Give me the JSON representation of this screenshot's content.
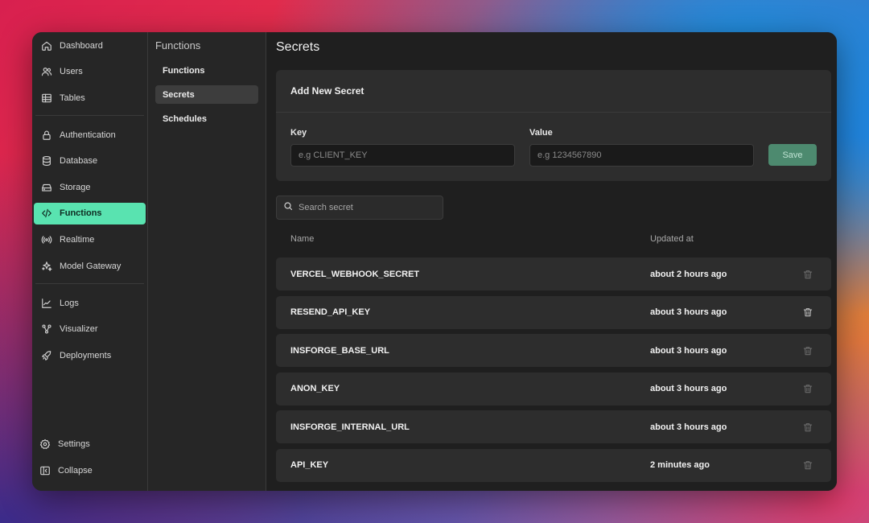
{
  "sidebar": {
    "groups": [
      [
        {
          "label": "Dashboard",
          "icon": "home-icon"
        },
        {
          "label": "Users",
          "icon": "users-icon"
        },
        {
          "label": "Tables",
          "icon": "table-icon"
        }
      ],
      [
        {
          "label": "Authentication",
          "icon": "lock-icon"
        },
        {
          "label": "Database",
          "icon": "database-icon"
        },
        {
          "label": "Storage",
          "icon": "storage-icon"
        },
        {
          "label": "Functions",
          "icon": "code-icon",
          "active": true
        },
        {
          "label": "Realtime",
          "icon": "broadcast-icon"
        },
        {
          "label": "Model Gateway",
          "icon": "sparkles-icon"
        }
      ],
      [
        {
          "label": "Logs",
          "icon": "chart-line-icon"
        },
        {
          "label": "Visualizer",
          "icon": "graph-icon"
        },
        {
          "label": "Deployments",
          "icon": "rocket-icon"
        }
      ]
    ],
    "bottom": [
      {
        "label": "Settings",
        "icon": "gear-icon"
      },
      {
        "label": "Collapse",
        "icon": "collapse-icon"
      }
    ],
    "accent_color": "#59e3b0"
  },
  "subnav": {
    "title": "Functions",
    "items": [
      {
        "label": "Functions"
      },
      {
        "label": "Secrets",
        "active": true
      },
      {
        "label": "Schedules"
      }
    ]
  },
  "main": {
    "title": "Secrets",
    "add_card": {
      "title": "Add New Secret",
      "key_label": "Key",
      "key_placeholder": "e.g CLIENT_KEY",
      "key_value": "",
      "value_label": "Value",
      "value_placeholder": "e.g 1234567890",
      "value_value": "",
      "save_label": "Save"
    },
    "search": {
      "placeholder": "Search secret",
      "value": ""
    },
    "table": {
      "columns": [
        "Name",
        "Updated at"
      ],
      "rows": [
        {
          "name": "VERCEL_WEBHOOK_SECRET",
          "updated": "about 2 hours ago"
        },
        {
          "name": "RESEND_API_KEY",
          "updated": "about 3 hours ago"
        },
        {
          "name": "INSFORGE_BASE_URL",
          "updated": "about 3 hours ago"
        },
        {
          "name": "ANON_KEY",
          "updated": "about 3 hours ago"
        },
        {
          "name": "INSFORGE_INTERNAL_URL",
          "updated": "about 3 hours ago"
        },
        {
          "name": "API_KEY",
          "updated": "2 minutes ago"
        }
      ]
    }
  }
}
